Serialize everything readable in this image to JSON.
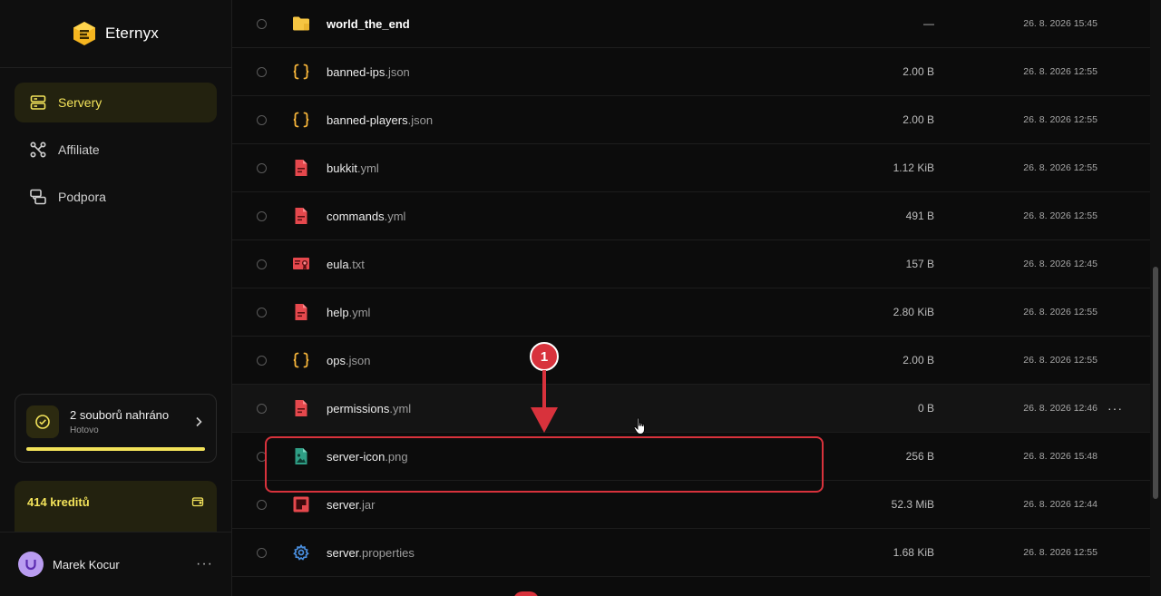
{
  "brand": {
    "name": "Eternyx"
  },
  "nav": [
    {
      "label": "Servery",
      "icon": "server-icon",
      "active": true
    },
    {
      "label": "Affiliate",
      "icon": "affiliate-icon",
      "active": false
    },
    {
      "label": "Podpora",
      "icon": "chat-icon",
      "active": false
    }
  ],
  "upload": {
    "title": "2 souborů nahráno",
    "status": "Hotovo",
    "progress": 1.0
  },
  "credits": {
    "label": "414 kreditů"
  },
  "user": {
    "name": "Marek Kocur",
    "menu": "···"
  },
  "files": [
    {
      "base": "world_the_end",
      "ext": "",
      "size": "—",
      "date": "26. 8. 2026 15:45",
      "icon": "folder-icon",
      "folder": true
    },
    {
      "base": "banned-ips",
      "ext": ".json",
      "size": "2.00 B",
      "date": "26. 8. 2026 12:55",
      "icon": "json-icon"
    },
    {
      "base": "banned-players",
      "ext": ".json",
      "size": "2.00 B",
      "date": "26. 8. 2026 12:55",
      "icon": "json-icon"
    },
    {
      "base": "bukkit",
      "ext": ".yml",
      "size": "1.12 KiB",
      "date": "26. 8. 2026 12:55",
      "icon": "yml-file-icon"
    },
    {
      "base": "commands",
      "ext": ".yml",
      "size": "491 B",
      "date": "26. 8. 2026 12:55",
      "icon": "yml-file-icon"
    },
    {
      "base": "eula",
      "ext": ".txt",
      "size": "157 B",
      "date": "26. 8. 2026 12:45",
      "icon": "certificate-icon"
    },
    {
      "base": "help",
      "ext": ".yml",
      "size": "2.80 KiB",
      "date": "26. 8. 2026 12:55",
      "icon": "yml-file-icon"
    },
    {
      "base": "ops",
      "ext": ".json",
      "size": "2.00 B",
      "date": "26. 8. 2026 12:55",
      "icon": "json-icon"
    },
    {
      "base": "permissions",
      "ext": ".yml",
      "size": "0 B",
      "date": "26. 8. 2026 12:46",
      "icon": "yml-file-icon",
      "hover": true,
      "menu": "···"
    },
    {
      "base": "server-icon",
      "ext": ".png",
      "size": "256 B",
      "date": "26. 8. 2026 15:48",
      "icon": "image-file-icon"
    },
    {
      "base": "server",
      "ext": ".jar",
      "size": "52.3 MiB",
      "date": "26. 8. 2026 12:44",
      "icon": "jar-file-icon"
    },
    {
      "base": "server",
      "ext": ".properties",
      "size": "1.68 KiB",
      "date": "26. 8. 2026 12:55",
      "icon": "gear-icon"
    }
  ],
  "annotation": {
    "step": "1"
  },
  "colors": {
    "accent": "#f3e35a",
    "annotation": "#d8323c",
    "json": "#f5b43a",
    "yml": "#e5484d",
    "png": "#3fb59a",
    "gear": "#4a90e2"
  }
}
